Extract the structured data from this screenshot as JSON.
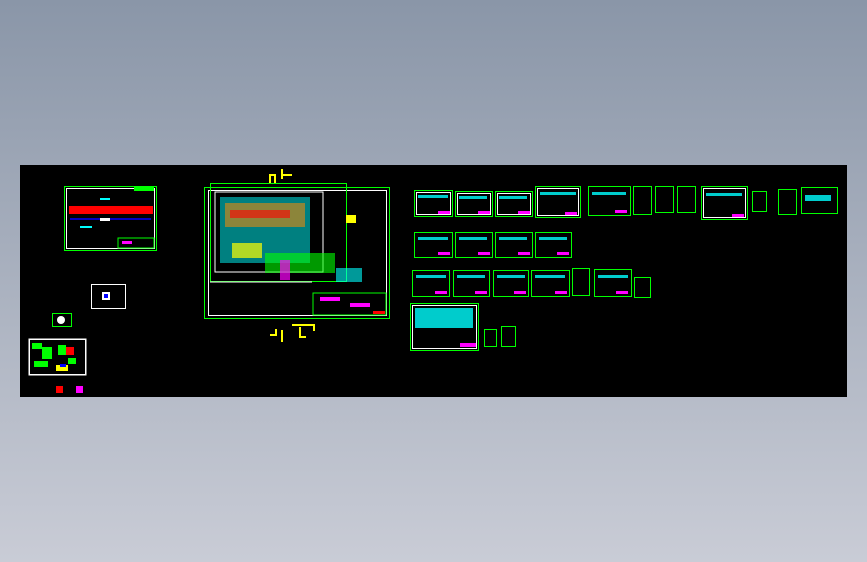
{
  "viewer": {
    "background_top": "#8a96a8",
    "background_bottom": "#c9ccd6",
    "model_space_color": "#000000"
  },
  "colors": {
    "frame": "#00ff00",
    "border": "#ffffff",
    "cyan": "#00ffff",
    "yellow": "#ffff00",
    "red": "#ff0000",
    "magenta": "#ff00ff",
    "blue": "#0000ff"
  }
}
